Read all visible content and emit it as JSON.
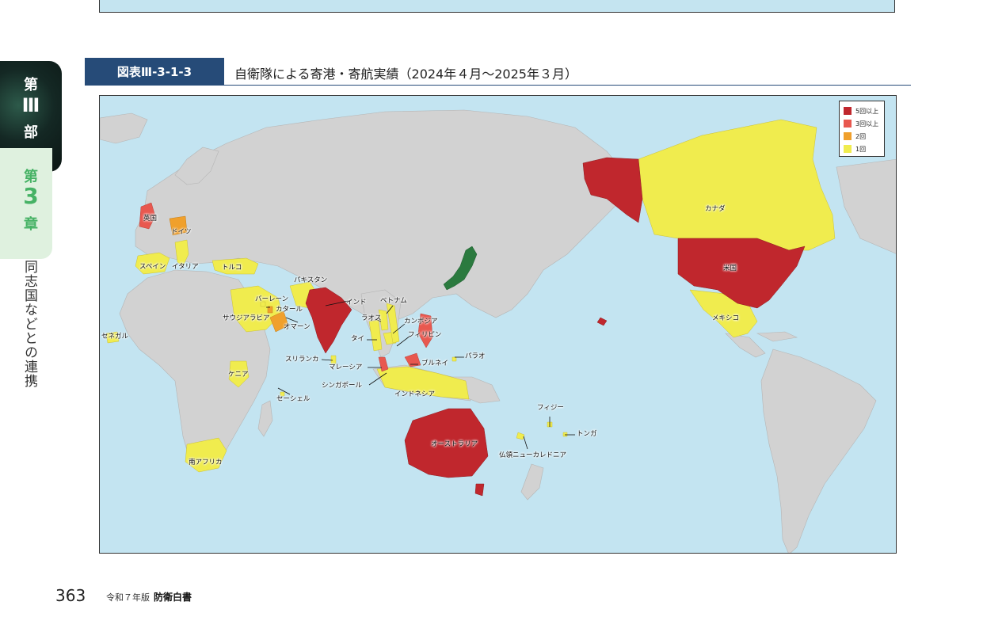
{
  "side_tab": {
    "part_prefix": "第",
    "part_number": "Ⅲ",
    "part_suffix": "部",
    "chapter_prefix": "第",
    "chapter_number": "3",
    "chapter_suffix": "章",
    "section_title": "同志国などとの連携"
  },
  "figure": {
    "badge": "図表Ⅲ-3-1-3",
    "title": "自衛隊による寄港・寄航実績（2024年４月〜2025年３月）"
  },
  "legend": [
    {
      "label": "5回以上",
      "color": "#c0272d"
    },
    {
      "label": "3回以上",
      "color": "#e8584f"
    },
    {
      "label": "2回",
      "color": "#f0a02c"
    },
    {
      "label": "1回",
      "color": "#f0ec4e"
    }
  ],
  "colors": {
    "ocean": "#c3e4f1",
    "land": "#d2d2d2",
    "japan": "#2b7a3f",
    "tier_5plus": "#c0272d",
    "tier_3plus": "#e8584f",
    "tier_2": "#f0a02c",
    "tier_1": "#f0ec4e"
  },
  "countries": {
    "uk": "英国",
    "germany": "ドイツ",
    "spain": "スペイン",
    "italy": "イタリア",
    "turkey": "トルコ",
    "pakistan": "パキスタン",
    "bahrain": "バーレーン",
    "qatar": "カタール",
    "saudi": "サウジアラビア",
    "oman": "オマーン",
    "senegal": "セネガル",
    "kenya": "ケニア",
    "seychelles": "セーシェル",
    "south_africa": "南アフリカ",
    "india": "インド",
    "sri_lanka": "スリランカ",
    "vietnam": "ベトナム",
    "laos": "ラオス",
    "cambodia": "カンボジア",
    "thailand": "タイ",
    "philippines": "フィリピン",
    "malaysia": "マレーシア",
    "brunei": "ブルネイ",
    "palau": "パラオ",
    "singapore": "シンガポール",
    "indonesia": "インドネシア",
    "australia": "オーストラリア",
    "new_caledonia": "仏領ニューカレドニア",
    "fiji": "フィジー",
    "tonga": "トンガ",
    "canada": "カナダ",
    "usa": "米国",
    "mexico": "メキシコ"
  },
  "footer": {
    "page_number": "363",
    "year": "令和７年版",
    "book": "防衛白書"
  }
}
